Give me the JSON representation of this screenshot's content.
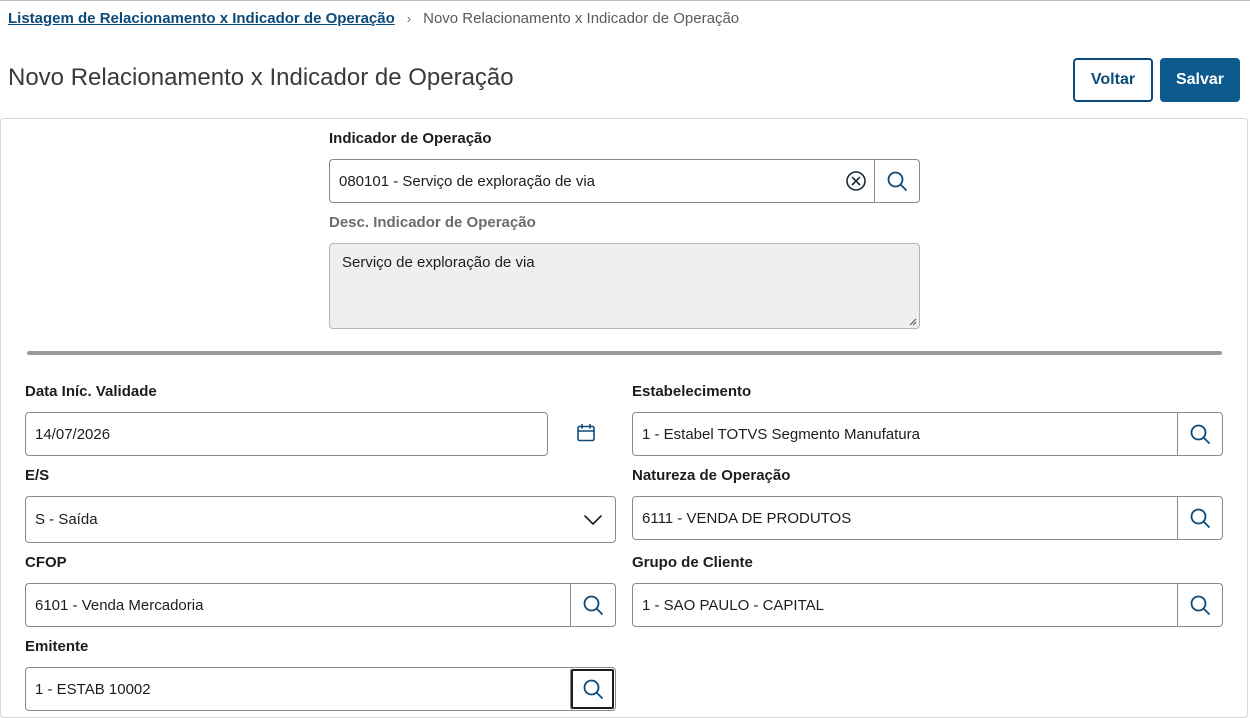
{
  "breadcrumb": {
    "link": "Listagem de Relacionamento x Indicador de Operação",
    "separator": "›",
    "current": "Novo Relacionamento x Indicador de Operação"
  },
  "page": {
    "title": "Novo Relacionamento x Indicador de Operação"
  },
  "actions": {
    "back_label": "Voltar",
    "save_label": "Salvar"
  },
  "form": {
    "indicador": {
      "label": "Indicador de Operação",
      "value": "080101 - Serviço de exploração de via"
    },
    "desc_indicador": {
      "label": "Desc. Indicador de Operação",
      "value": "Serviço de exploração de via"
    },
    "data_inic": {
      "label": "Data Iníc. Validade",
      "value": "14/07/2026"
    },
    "estabelecimento": {
      "label": "Estabelecimento",
      "value": "1 - Estabel TOTVS Segmento Manufatura"
    },
    "es": {
      "label": "E/S",
      "value": "S - Saída"
    },
    "natureza": {
      "label": "Natureza de Operação",
      "value": "6111 - VENDA DE PRODUTOS"
    },
    "cfop": {
      "label": "CFOP",
      "value": "6101 - Venda Mercadoria"
    },
    "grupo_cliente": {
      "label": "Grupo de Cliente",
      "value": "1 - SAO PAULO - CAPITAL"
    },
    "emitente": {
      "label": "Emitente",
      "value": "1 - ESTAB 10002"
    }
  },
  "colors": {
    "primary": "#0c5a8e",
    "link": "#0c4a7a",
    "icon": "#0c4a7a"
  },
  "icons": {
    "lookup": "search-icon",
    "clear": "clear-circle-icon",
    "calendar": "calendar-icon",
    "select": "chevron-down-icon",
    "breadcrumb_sep": "chevron-right-icon"
  }
}
